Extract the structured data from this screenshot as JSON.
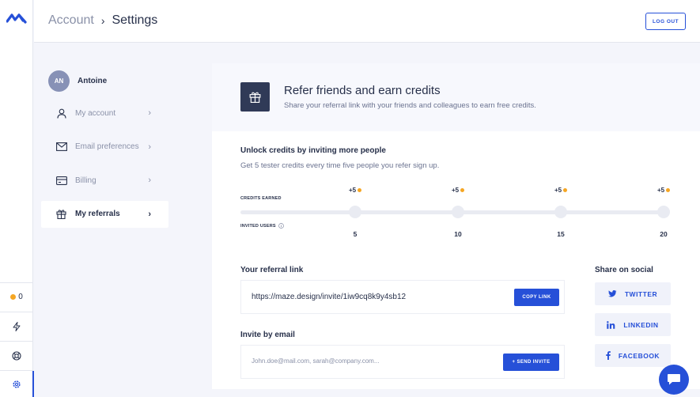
{
  "header": {
    "breadcrumb_parent": "Account",
    "breadcrumb_sep": "›",
    "breadcrumb_current": "Settings",
    "logout_label": "LOG OUT"
  },
  "rail": {
    "credits_count": "0",
    "credits_dot_color": "#f5a623"
  },
  "user": {
    "initials": "AN",
    "name": "Antoine"
  },
  "menu": {
    "items": [
      {
        "label": "My account",
        "icon": "user-icon"
      },
      {
        "label": "Email preferences",
        "icon": "mail-icon"
      },
      {
        "label": "Billing",
        "icon": "card-icon"
      },
      {
        "label": "My referrals",
        "icon": "gift-icon",
        "active": true
      }
    ]
  },
  "referral": {
    "title": "Refer friends and earn credits",
    "subtitle": "Share your referral link with your friends and colleagues to earn free credits.",
    "unlock_title": "Unlock credits by inviting more people",
    "unlock_sub": "Get 5 tester credits every time five people you refer sign up.",
    "credits_earned_label": "CREDITS EARNED",
    "invited_users_label": "INVITED USERS",
    "milestones": [
      {
        "credit": "+5",
        "users": "5"
      },
      {
        "credit": "+5",
        "users": "10"
      },
      {
        "credit": "+5",
        "users": "15"
      },
      {
        "credit": "+5",
        "users": "20"
      }
    ],
    "link_title": "Your referral link",
    "link_value": "https://maze.design/invite/1iw9cq8k9y4sb12",
    "copy_label": "COPY LINK",
    "invite_title": "Invite by email",
    "invite_placeholder": "John.doe@mail.com, sarah@company.com...",
    "send_label": "+ SEND INVITE",
    "share_title": "Share on social",
    "social": [
      {
        "label": "TWITTER",
        "icon": "twitter-icon"
      },
      {
        "label": "LINKEDIN",
        "icon": "linkedin-icon"
      },
      {
        "label": "FACEBOOK",
        "icon": "facebook-icon"
      }
    ]
  },
  "colors": {
    "accent": "#2650d8",
    "dark": "#27304a",
    "muted": "#8a91a8",
    "coin": "#f5a623"
  }
}
